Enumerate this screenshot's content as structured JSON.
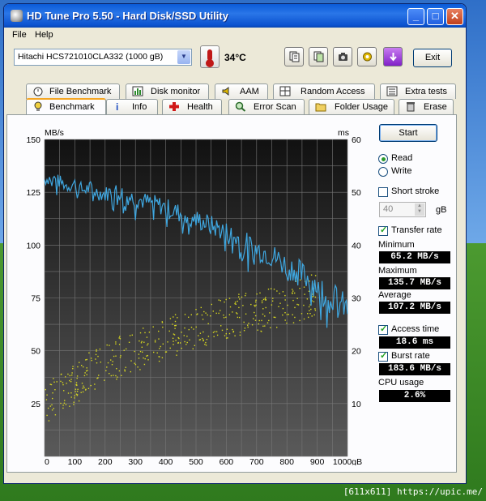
{
  "window": {
    "title": "HD Tune Pro 5.50 - Hard Disk/SSD Utility",
    "controls": {
      "minimize": "_",
      "maximize": "□",
      "close": "✕"
    }
  },
  "menu": {
    "file": "File",
    "help": "Help"
  },
  "toolbar": {
    "drive": "Hitachi HCS721010CLA332 (1000 gB)",
    "temperature": "34°C",
    "exit_label": "Exit",
    "icons": [
      "copy-text-icon",
      "copy-info-icon",
      "screenshot-icon",
      "options-icon",
      "save-icon"
    ]
  },
  "tabs": {
    "row1": [
      "File Benchmark",
      "Disk monitor",
      "AAM",
      "Random Access",
      "Extra tests"
    ],
    "row2": [
      "Benchmark",
      "Info",
      "Health",
      "Error Scan",
      "Folder Usage",
      "Erase"
    ],
    "active": "Benchmark"
  },
  "side": {
    "start_label": "Start",
    "read_label": "Read",
    "write_label": "Write",
    "mode": "Read",
    "short_stroke_label": "Short stroke",
    "short_stroke_checked": false,
    "short_stroke_value": "40",
    "short_stroke_unit": "gB",
    "transfer_rate_label": "Transfer rate",
    "transfer_rate_checked": true,
    "minimum_label": "Minimum",
    "minimum_value": "65.2 MB/s",
    "maximum_label": "Maximum",
    "maximum_value": "135.7 MB/s",
    "average_label": "Average",
    "average_value": "107.2 MB/s",
    "access_time_label": "Access time",
    "access_time_checked": true,
    "access_time_value": "18.6 ms",
    "burst_rate_label": "Burst rate",
    "burst_rate_checked": true,
    "burst_rate_value": "183.6 MB/s",
    "cpu_label": "CPU usage",
    "cpu_value": "2.6%"
  },
  "chart_data": {
    "type": "line",
    "left_unit": "MB/s",
    "right_unit": "ms",
    "x_ticks": [
      "0",
      "100",
      "200",
      "300",
      "400",
      "500",
      "600",
      "700",
      "800",
      "900",
      "1000gB"
    ],
    "y_left_ticks": [
      "150",
      "125",
      "100",
      "75",
      "50",
      "25"
    ],
    "y_right_ticks": [
      "60",
      "50",
      "40",
      "30",
      "20",
      "10"
    ],
    "xlim": [
      0,
      1000
    ],
    "ylim_left": [
      0,
      150
    ],
    "ylim_right": [
      0,
      60
    ],
    "grid": true,
    "transfer_series": {
      "name": "Transfer rate",
      "color": "#3fa7e0",
      "x": [
        0,
        25,
        50,
        75,
        100,
        125,
        150,
        175,
        200,
        225,
        250,
        275,
        300,
        325,
        350,
        375,
        400,
        425,
        450,
        475,
        500,
        525,
        550,
        575,
        600,
        625,
        650,
        675,
        700,
        725,
        750,
        775,
        800,
        825,
        850,
        875,
        900,
        925,
        950,
        975,
        1000
      ],
      "y": [
        131,
        132,
        130,
        128,
        129,
        126,
        127,
        125,
        124,
        126,
        125,
        123,
        122,
        121,
        120,
        119,
        118,
        116,
        115,
        114,
        112,
        111,
        109,
        108,
        106,
        104,
        102,
        100,
        98,
        97,
        95,
        93,
        90,
        89,
        86,
        84,
        81,
        79,
        76,
        73,
        69
      ]
    },
    "access_series": {
      "name": "Access time",
      "color": "#d8d820",
      "x": [
        0,
        50,
        100,
        150,
        200,
        250,
        300,
        350,
        400,
        450,
        500,
        550,
        600,
        650,
        700,
        750,
        800,
        850,
        900
      ],
      "y": [
        10,
        12.5,
        14,
        16,
        17.5,
        19,
        20,
        21.5,
        22.5,
        23.5,
        24.5,
        25.5,
        26.5,
        27,
        27.5,
        28,
        29,
        30,
        31
      ]
    }
  },
  "footer": "[611x611] https://upic.me/"
}
